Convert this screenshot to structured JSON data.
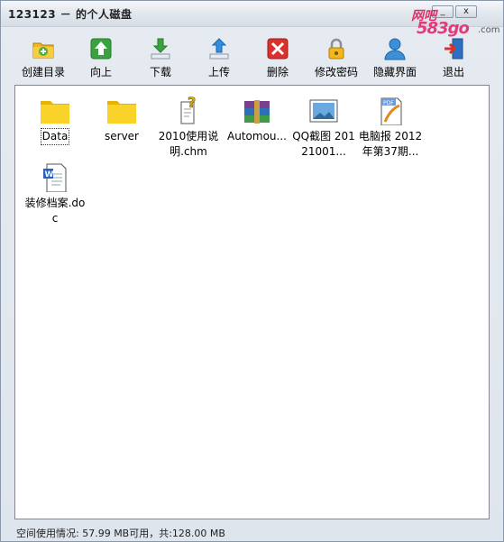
{
  "window": {
    "title": "123123 － 的个人磁盘"
  },
  "watermark": {
    "top": "网吧",
    "num": "58",
    "num2": "3go",
    "com": ".com"
  },
  "toolbar": {
    "items": [
      {
        "label": "创建目录",
        "icon": "folder-add-icon"
      },
      {
        "label": "向上",
        "icon": "arrow-up-icon"
      },
      {
        "label": "下载",
        "icon": "download-icon"
      },
      {
        "label": "上传",
        "icon": "upload-icon"
      },
      {
        "label": "删除",
        "icon": "delete-icon"
      },
      {
        "label": "修改密码",
        "icon": "lock-icon"
      },
      {
        "label": "隐藏界面",
        "icon": "user-icon"
      },
      {
        "label": "退出",
        "icon": "exit-icon"
      }
    ]
  },
  "files": [
    {
      "name": "Data",
      "type": "folder"
    },
    {
      "name": "server",
      "type": "folder"
    },
    {
      "name": "2010使用说明.chm",
      "type": "chm"
    },
    {
      "name": "Automou...",
      "type": "rar"
    },
    {
      "name": "QQ截图 20121001...",
      "type": "image"
    },
    {
      "name": "电脑报 2012年第37期...",
      "type": "pdf"
    },
    {
      "name": "装修档案.doc",
      "type": "doc"
    }
  ],
  "status": {
    "text": "空间使用情况: 57.99 MB可用，共:128.00 MB"
  },
  "colors": {
    "folder": "#f7c600",
    "accent_pink": "#e33a7a",
    "delete_red": "#d9322c",
    "up_green": "#3aa23e"
  }
}
